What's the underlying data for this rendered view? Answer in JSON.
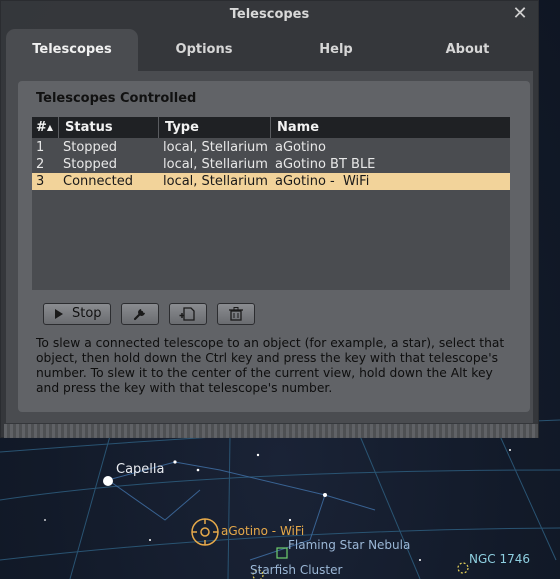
{
  "window": {
    "title": "Telescopes",
    "close_icon": "close-icon"
  },
  "tabs": [
    {
      "label": "Telescopes",
      "active": true
    },
    {
      "label": "Options",
      "active": false
    },
    {
      "label": "Help",
      "active": false
    },
    {
      "label": "About",
      "active": false
    }
  ],
  "section_title": "Telescopes Controlled",
  "table": {
    "headers": [
      "#",
      "Status",
      "Type",
      "Name"
    ],
    "rows": [
      {
        "num": "1",
        "status": "Stopped",
        "type": "local, Stellarium",
        "name": "aGotino",
        "selected": false
      },
      {
        "num": "2",
        "status": "Stopped",
        "type": "local, Stellarium",
        "name": "aGotino BT BLE",
        "selected": false
      },
      {
        "num": "3",
        "status": "Connected",
        "type": "local, Stellarium",
        "name": "aGotino -  WiFi",
        "selected": true
      }
    ]
  },
  "buttons": {
    "stop_label": "Stop",
    "stop_icon": "play-icon",
    "configure_icon": "wrench-icon",
    "add_icon": "add-document-icon",
    "remove_icon": "trash-icon"
  },
  "help_text": "To slew a connected telescope to an object (for example, a star), select that object, then hold down the Ctrl key and press the key with that telescope's number. To slew it to the center of the current view, hold down the Alt key and press the key with that telescope's number.",
  "sky_labels": {
    "capella": "Capella",
    "telescope_marker": "aGotino -  WiFi",
    "flaming_star": "Flaming Star Nebula",
    "starfish": "Starfish Cluster",
    "ngc1746": "NGC 1746"
  },
  "colors": {
    "selected_row": "#f2d39a",
    "telescope_marker": "#e6a94a"
  }
}
